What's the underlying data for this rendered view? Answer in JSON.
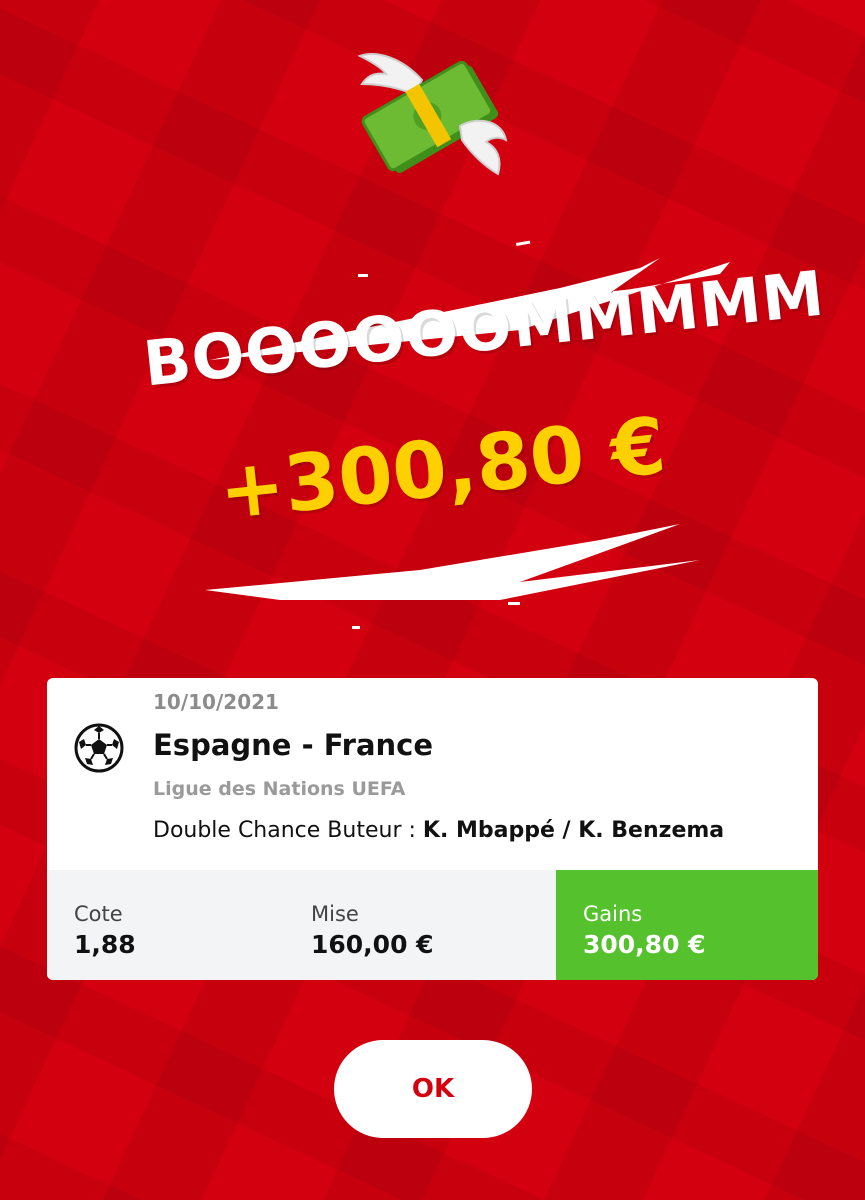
{
  "header": {
    "icon": "money-with-wings-icon",
    "title": "BOOOOOOMMMMM",
    "amount": "+300,80 €"
  },
  "bet": {
    "date": "10/10/2021",
    "sport_icon": "soccer-ball-icon",
    "match": "Espagne - France",
    "league": "Ligue des Nations UEFA",
    "market": "Double Chance Buteur :",
    "selection": "K. Mbappé / K. Benzema"
  },
  "summary": {
    "cote_label": "Cote",
    "cote_value": "1,88",
    "mise_label": "Mise",
    "mise_value": "160,00 €",
    "gains_label": "Gains",
    "gains_value": "300,80 €"
  },
  "actions": {
    "ok_label": "OK"
  },
  "colors": {
    "background": "#d3000f",
    "amount": "#ffd000",
    "gains": "#55c22d"
  }
}
